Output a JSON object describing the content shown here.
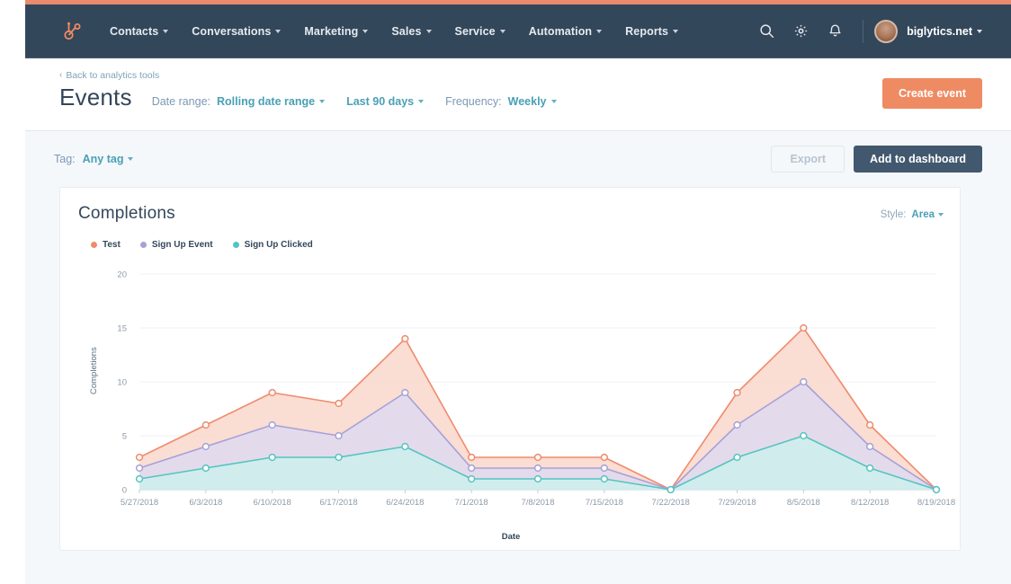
{
  "nav": {
    "logo_icon": "hubspot-sprocket-logo",
    "items": [
      {
        "label": "Contacts",
        "has_caret": true
      },
      {
        "label": "Conversations",
        "has_caret": true
      },
      {
        "label": "Marketing",
        "has_caret": true
      },
      {
        "label": "Sales",
        "has_caret": true
      },
      {
        "label": "Service",
        "has_caret": true
      },
      {
        "label": "Automation",
        "has_caret": true
      },
      {
        "label": "Reports",
        "has_caret": true
      }
    ],
    "icons": [
      "search-icon",
      "gear-icon",
      "bell-icon"
    ],
    "account": "biglytics.net"
  },
  "header": {
    "back_link": "Back to analytics tools",
    "back_chevron": "‹",
    "title": "Events",
    "date_range_label": "Date range:",
    "date_range_value": "Rolling date range",
    "date_preset_value": "Last 90 days",
    "frequency_label": "Frequency:",
    "frequency_value": "Weekly",
    "create_button": "Create event"
  },
  "toolbar": {
    "tag_label": "Tag:",
    "tag_value": "Any tag",
    "export_button": "Export",
    "dashboard_button": "Add to dashboard"
  },
  "card": {
    "title": "Completions",
    "style_label": "Style:",
    "style_value": "Area"
  },
  "colors": {
    "accent_orange": "#ef8b63",
    "nav_bg": "#33475b",
    "link_teal": "#49a0b5",
    "page_bg": "#f5f8fa",
    "series_test": "#ef8b6c",
    "series_signup_event": "#a6a1d8",
    "series_signup_clicked": "#55c4c0"
  },
  "chart_data": {
    "type": "area",
    "title": "Completions",
    "xlabel": "Date",
    "ylabel": "Completions",
    "ylim": [
      0,
      20
    ],
    "yticks": [
      0,
      5,
      10,
      15,
      20
    ],
    "grid": true,
    "legend_position": "top-left",
    "stacked": false,
    "categories": [
      "5/27/2018",
      "6/3/2018",
      "6/10/2018",
      "6/17/2018",
      "6/24/2018",
      "7/1/2018",
      "7/8/2018",
      "7/15/2018",
      "7/22/2018",
      "7/29/2018",
      "8/5/2018",
      "8/12/2018",
      "8/19/2018"
    ],
    "series": [
      {
        "name": "Test",
        "color": "#ef8b6c",
        "fill": "#f9d7cb",
        "values": [
          3,
          6,
          9,
          8,
          14,
          3,
          3,
          3,
          0,
          9,
          15,
          6,
          0
        ]
      },
      {
        "name": "Sign Up Event",
        "color": "#a6a1d8",
        "fill": "#dedaf0",
        "values": [
          2,
          4,
          6,
          5,
          9,
          2,
          2,
          2,
          0,
          6,
          10,
          4,
          0
        ]
      },
      {
        "name": "Sign Up Clicked",
        "color": "#55c4c0",
        "fill": "#cdeeec",
        "values": [
          1,
          2,
          3,
          3,
          4,
          1,
          1,
          1,
          0,
          3,
          5,
          2,
          0
        ]
      }
    ]
  }
}
